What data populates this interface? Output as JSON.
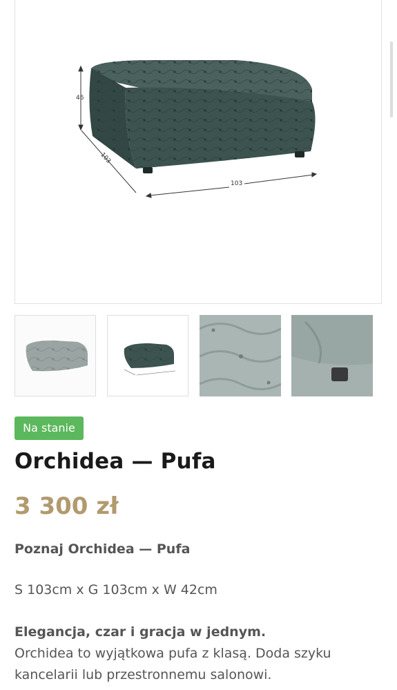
{
  "product": {
    "dimension_labels": {
      "height": "46",
      "depth": "103",
      "width": "103"
    },
    "thumbnails": [
      {
        "name": "light-grey pouf"
      },
      {
        "name": "dark green pouf with dimensions"
      },
      {
        "name": "tufted fabric close-up"
      },
      {
        "name": "pouf leg close-up"
      }
    ],
    "stock_badge": "Na stanie",
    "title": "Orchidea — Pufa",
    "price": "3 300 zł",
    "intro": "Poznaj Orchidea — Pufa",
    "dimensions": "S 103cm x G 103cm x W 42cm",
    "description_lead": "Elegancja, czar i gracja w jednym.",
    "description_body": "Orchidea to wyjątkowa pufa z klasą. Doda szyku kancelarii lub przestronnemu salonowi."
  },
  "colors": {
    "badge": "#5cb85c",
    "price": "#b19a6e",
    "pouf_dark": "#3c5350",
    "pouf_light": "#9aa5a3"
  }
}
